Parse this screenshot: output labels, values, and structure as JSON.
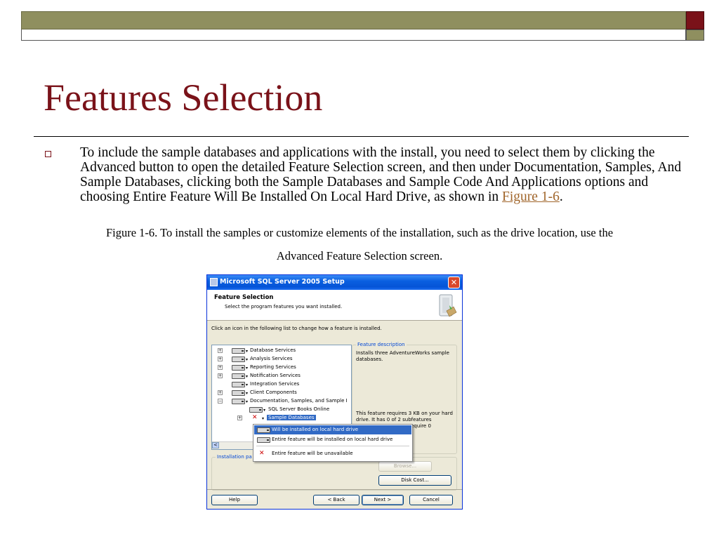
{
  "slide": {
    "title": "Features Selection",
    "bullet_text": "To include the sample databases and applications with the install, you need to select them by clicking the Advanced button to open the detailed Feature Selection screen, and then under Documentation, Samples, And Sample Databases, clicking both the Sample Databases and Sample Code And Applications options and choosing Entire Feature Will Be Installed On Local Hard Drive, as shown in ",
    "bullet_link": "Figure 1-6",
    "bullet_end": ".",
    "caption_line1": "Figure 1-6. To install the samples or customize elements of the installation, such as the drive location, use the",
    "caption_line2": "Advanced Feature Selection screen.",
    "colors": {
      "title": "#7a1219",
      "band": "#8f8f5f",
      "link": "#a0652a"
    }
  },
  "dialog": {
    "window_title": "Microsoft SQL Server 2005 Setup",
    "header_title": "Feature Selection",
    "header_subtitle": "Select the program features you want installed.",
    "instruction": "Click an icon in the following list to change how a feature is installed.",
    "tree": [
      {
        "label": "Database Services"
      },
      {
        "label": "Analysis Services"
      },
      {
        "label": "Reporting Services"
      },
      {
        "label": "Notification Services"
      },
      {
        "label": "Integration Services"
      },
      {
        "label": "Client Components"
      },
      {
        "label": "Documentation, Samples, and Sample I"
      },
      {
        "label": "SQL Server Books Online"
      },
      {
        "label": "Sample Databases"
      }
    ],
    "scroll_left": "<",
    "feature_description_legend": "Feature description",
    "feature_description_text": "Installs three AdventureWorks sample databases.",
    "feature_requirements_text": "This feature requires 3 KB on your hard drive. It has 0 of 2 subfeatures",
    "feature_requirements_tail": "ures require 0",
    "menu": [
      {
        "label": "Will be installed on local hard drive"
      },
      {
        "label": "Entire feature will be installed on local hard drive"
      },
      {
        "label": "Entire feature will be unavailable"
      }
    ],
    "installation_path_legend": "Installation pa",
    "buttons": {
      "browse": "Browse...",
      "disk_cost": "Disk Cost...",
      "help": "Help",
      "back": "< Back",
      "next": "Next >",
      "cancel": "Cancel"
    },
    "close_glyph": "✕"
  }
}
